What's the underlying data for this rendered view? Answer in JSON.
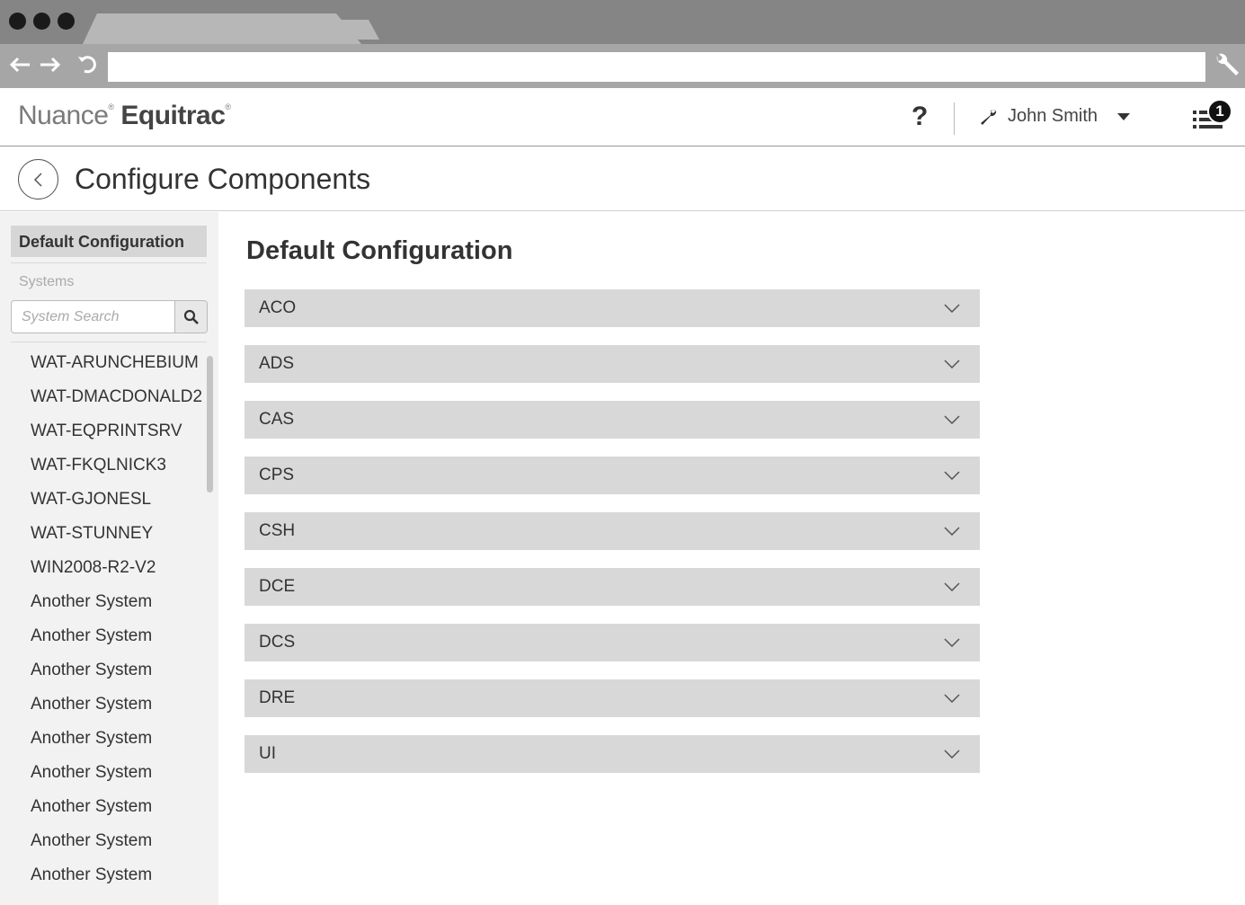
{
  "browser": {
    "address_value": ""
  },
  "app": {
    "brand": "Nuance",
    "product": "Equitrac",
    "help_label": "?",
    "user_name": "John Smith",
    "notification_count": "1"
  },
  "page": {
    "title": "Configure Components"
  },
  "sidebar": {
    "selected_label": "Default Configuration",
    "section_label": "Systems",
    "search_placeholder": "System Search",
    "systems": [
      "WAT-ARUNCHEBIUM",
      "WAT-DMACDONALD2",
      "WAT-EQPRINTSRV",
      "WAT-FKQLNICK3",
      "WAT-GJONESL",
      "WAT-STUNNEY",
      "WIN2008-R2-V2",
      "Another System",
      "Another System",
      "Another System",
      "Another System",
      "Another System",
      "Another System",
      "Another System",
      "Another System",
      "Another System"
    ]
  },
  "main": {
    "title": "Default Configuration",
    "components": [
      "ACO",
      "ADS",
      "CAS",
      "CPS",
      "CSH",
      "DCE",
      "DCS",
      "DRE",
      "UI"
    ]
  },
  "icons": {
    "back": "arrow-left-icon",
    "forward": "arrow-right-icon",
    "reload": "reload-icon",
    "settings": "wrench-icon",
    "help": "question-icon",
    "user": "wrench-icon",
    "menu": "list-icon",
    "search": "search-icon",
    "expand": "chevron-down-icon"
  }
}
